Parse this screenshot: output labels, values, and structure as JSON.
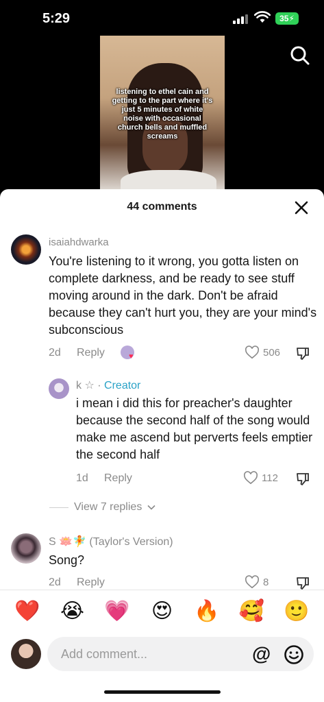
{
  "status_bar": {
    "time": "5:29",
    "battery": "35"
  },
  "video": {
    "overlay_text": "listening to ethel cain and getting to the part where it's just 5 minutes of white noise with occasional church bells and muffled screams"
  },
  "sheet": {
    "title": "44 comments"
  },
  "comments": [
    {
      "username": "isaiahdwarka",
      "text": "You're listening to it wrong, you gotta listen on complete darkness, and be ready to see stuff moving around in the dark. Don't be afraid because they can't hurt you, they are your mind's subconscious",
      "time": "2d",
      "reply_label": "Reply",
      "likes": "506"
    },
    {
      "username": "k ☆",
      "separator": "·",
      "badge": "Creator",
      "text": "i mean i did this for preacher's daughter because the second half of the song would make me ascend but perverts feels emptier the second half",
      "time": "1d",
      "reply_label": "Reply",
      "likes": "112"
    },
    {
      "username": "S 🪷🧚 (Taylor's Version)",
      "text": "Song?",
      "time": "2d",
      "reply_label": "Reply",
      "likes": "8"
    }
  ],
  "view_replies": "View 7 replies",
  "emojis": [
    "❤️",
    "😭",
    "💗",
    "😍",
    "🔥",
    "🥰",
    "🙂"
  ],
  "input": {
    "placeholder": "Add comment...",
    "at_symbol": "@"
  },
  "colors": {
    "creator": "#2aa2c7",
    "battery": "#30d158",
    "muted": "#8a8a8a"
  }
}
